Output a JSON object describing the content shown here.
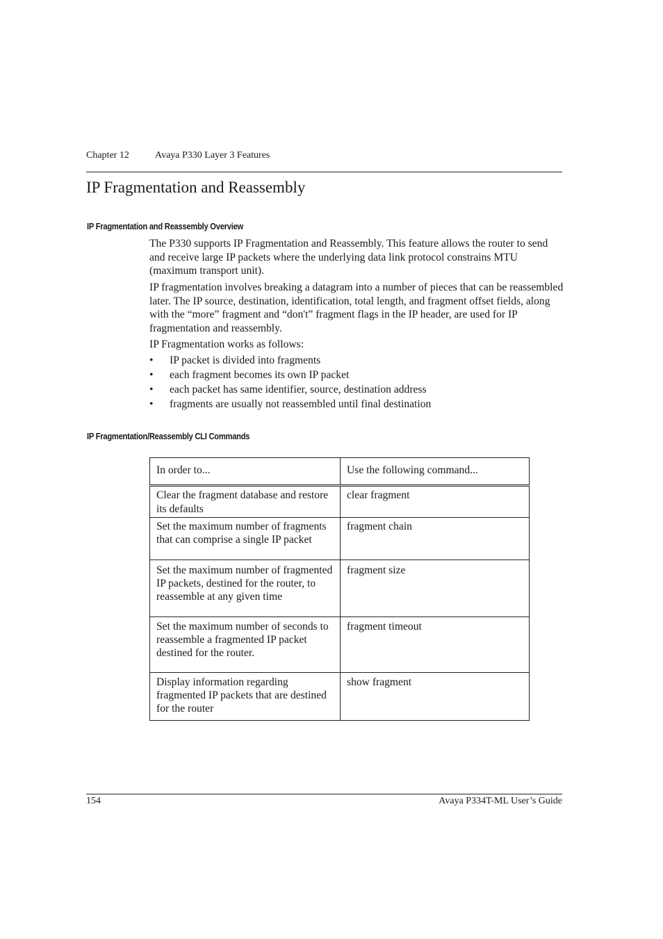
{
  "header": {
    "chapter": "Chapter 12",
    "chapter_title": "Avaya P330 Layer 3 Features"
  },
  "title": "IP Fragmentation and Reassembly",
  "sections": {
    "overview": {
      "heading": "IP Fragmentation and Reassembly Overview",
      "paragraphs": [
        "The P330 supports IP Fragmentation and Reassembly. This feature allows the router to send and receive large IP packets where the underlying data link protocol constrains MTU (maximum transport unit).",
        "IP fragmentation involves breaking a datagram into a number of pieces that can be reassembled later. The IP source, destination, identification, total length, and fragment offset fields, along with the “more” fragment and “don't” fragment flags in the IP header, are used for IP fragmentation and reassembly.",
        "IP Fragmentation works as follows:"
      ],
      "bullet_glyph": "•",
      "bullets": [
        "IP packet is divided into fragments",
        "each fragment becomes its own IP packet",
        "each packet has same identifier, source, destination address",
        "fragments are usually not reassembled until final destination"
      ]
    },
    "cli": {
      "heading": "IP Fragmentation/Reassembly CLI Commands",
      "table": {
        "columns": [
          "In order to...",
          "Use the following command..."
        ],
        "rows": [
          [
            "Clear the fragment database and restore its defaults",
            "clear fragment"
          ],
          [
            "Set the maximum number of fragments that can comprise a single IP packet",
            "fragment chain"
          ],
          [
            "Set the maximum number of fragmented IP packets, destined for the router, to reassemble at any given time",
            "fragment size"
          ],
          [
            "Set the maximum number of seconds to reassemble a fragmented IP packet destined for the router.",
            "fragment timeout"
          ],
          [
            "Display information regarding fragmented IP packets that are destined for the router",
            "show fragment"
          ]
        ]
      }
    }
  },
  "footer": {
    "page_number": "154",
    "guide_title": "Avaya P334T-ML User’s Guide"
  }
}
